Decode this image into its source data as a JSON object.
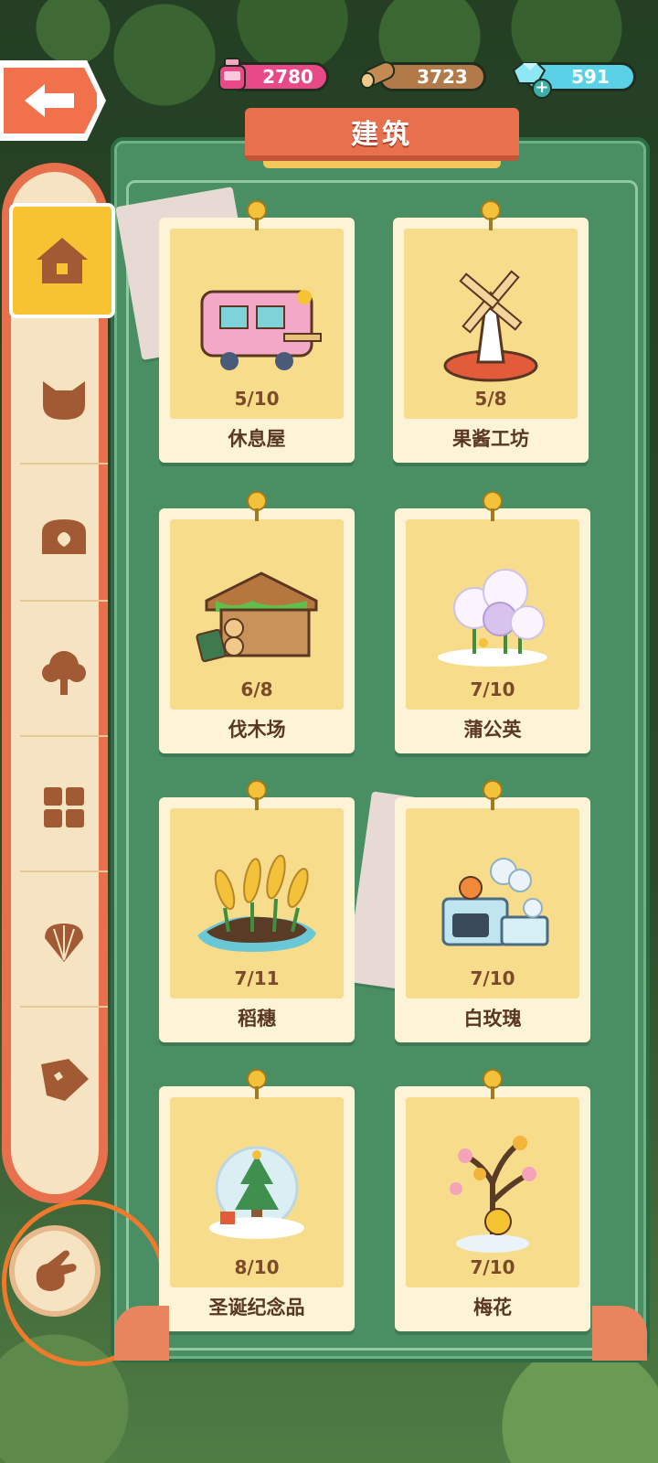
{
  "resources": {
    "ink": {
      "value": "2780",
      "icon": "ink-bottle-icon",
      "color": "#e94a87"
    },
    "wood": {
      "value": "3723",
      "icon": "log-icon",
      "color": "#b37a49"
    },
    "gems": {
      "value": "591",
      "icon": "gem-icon",
      "color": "#5ad1e6"
    }
  },
  "panel": {
    "title": "建筑"
  },
  "sidebar": {
    "tabs": [
      {
        "icon": "house-icon",
        "active": true
      },
      {
        "icon": "cat-face-icon",
        "active": false
      },
      {
        "icon": "treasure-chest-icon",
        "active": false
      },
      {
        "icon": "tree-icon",
        "active": false
      },
      {
        "icon": "grid-tiles-icon",
        "active": false
      },
      {
        "icon": "shell-icon",
        "active": false
      },
      {
        "icon": "tag-icon",
        "active": false
      }
    ],
    "bottom_button_icon": "pointing-hand-icon"
  },
  "buildings": [
    {
      "name": "休息屋",
      "level": "5/10",
      "icon": "rest-house-icon"
    },
    {
      "name": "果酱工坊",
      "level": "5/8",
      "icon": "windmill-icon"
    },
    {
      "name": "伐木场",
      "level": "6/8",
      "icon": "lumber-camp-icon"
    },
    {
      "name": "蒲公英",
      "level": "7/10",
      "icon": "dandelion-icon"
    },
    {
      "name": "稻穗",
      "level": "7/11",
      "icon": "rice-ear-icon"
    },
    {
      "name": "白玫瑰",
      "level": "7/10",
      "icon": "white-rose-icon"
    },
    {
      "name": "圣诞纪念品",
      "level": "8/10",
      "icon": "snow-globe-icon"
    },
    {
      "name": "梅花",
      "level": "7/10",
      "icon": "plum-blossom-icon"
    }
  ]
}
